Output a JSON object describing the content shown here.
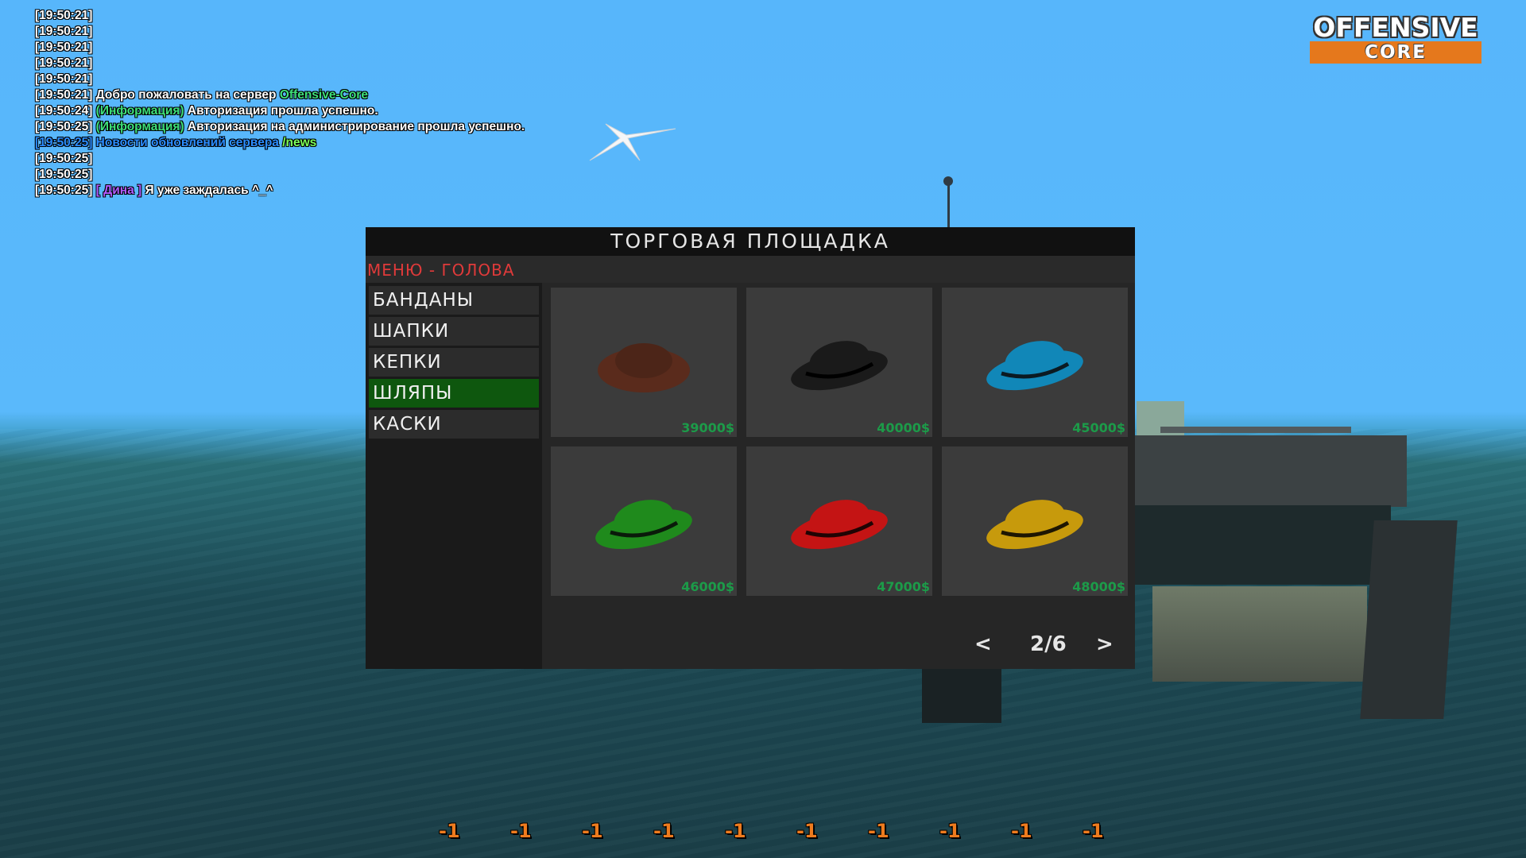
{
  "chat": [
    {
      "time": "[19:50:21]",
      "parts": []
    },
    {
      "time": "[19:50:21]",
      "parts": []
    },
    {
      "time": "[19:50:21]",
      "parts": []
    },
    {
      "time": "[19:50:21]",
      "parts": []
    },
    {
      "time": "[19:50:21]",
      "parts": []
    },
    {
      "time": "[19:50:21]",
      "parts": [
        {
          "text": " Добро пожаловать на сервер ",
          "color": ""
        },
        {
          "text": "Offensive-Core",
          "color": "green"
        }
      ]
    },
    {
      "time": "[19:50:24]",
      "parts": [
        {
          "text": " (Информация)",
          "color": "green"
        },
        {
          "text": " Авторизация прошла успешно.",
          "color": ""
        }
      ]
    },
    {
      "time": "[19:50:25]",
      "parts": [
        {
          "text": " (Информация)",
          "color": "green"
        },
        {
          "text": " Авторизация на администрирование прошла успешно.",
          "color": ""
        }
      ]
    },
    {
      "time": "[19:50:25]",
      "time_color": "blue",
      "parts": [
        {
          "text": " Новости обновлений сервера ",
          "color": "blue"
        },
        {
          "text": "/news",
          "color": "ltgreen"
        }
      ]
    },
    {
      "time": "[19:50:25]",
      "parts": []
    },
    {
      "time": "[19:50:25]",
      "parts": []
    },
    {
      "time": "[19:50:25]",
      "parts": [
        {
          "text": " [ Дина ]",
          "color": "purple"
        },
        {
          "text": " Я уже заждалась ^_^",
          "color": ""
        }
      ]
    }
  ],
  "logo": {
    "top": "OFFENSIVE",
    "bottom": "CORE",
    "accent": "#e5781c"
  },
  "market": {
    "title": "ТОРГОВАЯ ПЛОЩАДКА",
    "menu_label": "МЕНЮ - ГОЛОВА",
    "categories": [
      {
        "label": "БАНДАНЫ",
        "active": false
      },
      {
        "label": "ШАПКИ",
        "active": false
      },
      {
        "label": "КЕПКИ",
        "active": false
      },
      {
        "label": "ШЛЯПЫ",
        "active": true
      },
      {
        "label": "КАСКИ",
        "active": false
      }
    ],
    "items": [
      {
        "icon": "brown-hat-icon",
        "color": "#5a2b1c",
        "band": false,
        "price": "39000$"
      },
      {
        "icon": "black-hat-icon",
        "color": "#1a1a1a",
        "band": true,
        "price": "40000$"
      },
      {
        "icon": "blue-hat-icon",
        "color": "#1187b8",
        "band": true,
        "price": "45000$"
      },
      {
        "icon": "green-hat-icon",
        "color": "#1f8a1c",
        "band": true,
        "price": "46000$"
      },
      {
        "icon": "red-hat-icon",
        "color": "#c41414",
        "band": true,
        "price": "47000$"
      },
      {
        "icon": "yellow-hat-icon",
        "color": "#c79a0c",
        "band": true,
        "price": "48000$"
      }
    ],
    "pager": {
      "prev": "<",
      "page": "2/6",
      "next": ">"
    }
  },
  "bottom_values": [
    "-1",
    "-1",
    "-1",
    "-1",
    "-1",
    "-1",
    "-1",
    "-1",
    "-1",
    "-1"
  ]
}
